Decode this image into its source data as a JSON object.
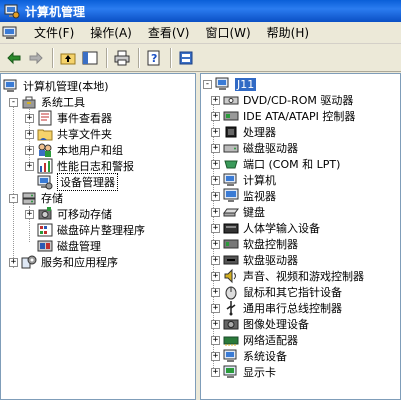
{
  "window": {
    "title": "计算机管理"
  },
  "menu": {
    "items": [
      "文件(F)",
      "操作(A)",
      "查看(V)",
      "窗口(W)",
      "帮助(H)"
    ]
  },
  "toolbar": {
    "buttons": [
      "back",
      "forward",
      "up",
      "show-hide-tree",
      "print",
      "help",
      "properties"
    ]
  },
  "left_tree": {
    "root": "计算机管理(本地)",
    "system_tools": "系统工具",
    "event_viewer": "事件查看器",
    "shared_folders": "共享文件夹",
    "local_users": "本地用户和组",
    "perf_logs": "性能日志和警报",
    "device_manager": "设备管理器",
    "storage": "存储",
    "removable_storage": "可移动存储",
    "defrag": "磁盘碎片整理程序",
    "disk_mgmt": "磁盘管理",
    "services_apps": "服务和应用程序"
  },
  "right_tree": {
    "root": "J11",
    "items": [
      "DVD/CD-ROM 驱动器",
      "IDE ATA/ATAPI 控制器",
      "处理器",
      "磁盘驱动器",
      "端口 (COM 和 LPT)",
      "计算机",
      "监视器",
      "键盘",
      "人体学输入设备",
      "软盘控制器",
      "软盘驱动器",
      "声音、视频和游戏控制器",
      "鼠标和其它指针设备",
      "通用串行总线控制器",
      "图像处理设备",
      "网络适配器",
      "系统设备",
      "显示卡"
    ]
  },
  "colors": {
    "title_bar": "#0a5fd8",
    "selection": "#316ac5",
    "window_bg": "#ece9d8",
    "pane_border": "#7f9db9"
  }
}
